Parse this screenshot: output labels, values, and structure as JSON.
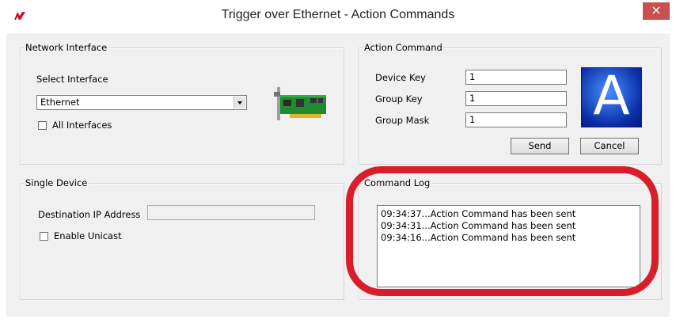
{
  "window": {
    "title": "Trigger over Ethernet - Action Commands",
    "close_glyph": "×",
    "app_icon": "logo-icon"
  },
  "network_interface": {
    "legend": "Network Interface",
    "select_label": "Select Interface",
    "selected_value": "Ethernet",
    "all_interfaces_label": "All Interfaces",
    "all_interfaces_checked": false,
    "image_icon": "network-card-icon"
  },
  "action_command": {
    "legend": "Action Command",
    "device_key_label": "Device Key",
    "device_key_value": "1",
    "group_key_label": "Group Key",
    "group_key_value": "1",
    "group_mask_label": "Group Mask",
    "group_mask_value": "1",
    "image_letter": "A",
    "send_label": "Send",
    "cancel_label": "Cancel"
  },
  "single_device": {
    "legend": "Single Device",
    "destination_ip_label": "Destination IP Address",
    "destination_ip_value": "",
    "enable_unicast_label": "Enable Unicast",
    "enable_unicast_checked": false
  },
  "command_log": {
    "legend": "Command Log",
    "entries": [
      "09:34:37...Action Command has been sent",
      "09:34:31...Action Command has been sent",
      "09:34:16...Action Command has been sent"
    ]
  },
  "colors": {
    "highlight": "#d81e2a",
    "close_button": "#c75050"
  }
}
